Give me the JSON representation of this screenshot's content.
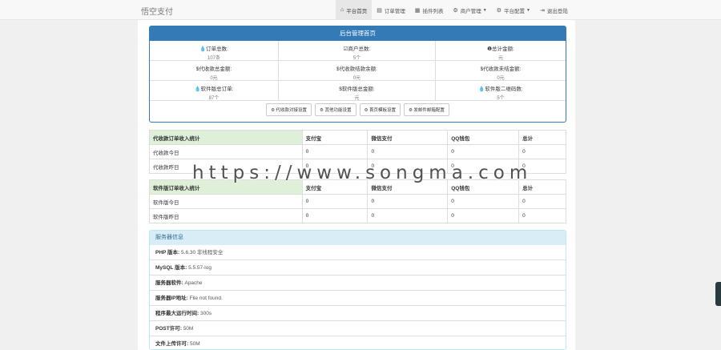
{
  "brand": "悟空支付",
  "nav": [
    {
      "icon": "⌂",
      "label": "平台首页",
      "active": true,
      "caret": false
    },
    {
      "icon": "▤",
      "label": "订单管理",
      "active": false,
      "caret": false
    },
    {
      "icon": "▦",
      "label": "插件列表",
      "active": false,
      "caret": false
    },
    {
      "icon": "⚙",
      "label": "商户管理",
      "active": false,
      "caret": true
    },
    {
      "icon": "⚙",
      "label": "平台配置",
      "active": false,
      "caret": true
    },
    {
      "icon": "⇥",
      "label": "退出登陆",
      "active": false,
      "caret": false
    }
  ],
  "panel": {
    "title": "后台管理首页",
    "stats": [
      {
        "label": "💧订单总数:",
        "value": "107条"
      },
      {
        "label": "☑商户总数:",
        "value": "5个"
      },
      {
        "label": "❶总计金额:",
        "value": "元"
      },
      {
        "label": "$代收款总金额:",
        "value": "0元"
      },
      {
        "label": "$代收款结款余额:",
        "value": "0元"
      },
      {
        "label": "$代收款未结金额:",
        "value": "0元"
      },
      {
        "label": "💧软件版总订单:",
        "value": "87个"
      },
      {
        "label": "$软件版总金额:",
        "value": "元"
      },
      {
        "label": "💧软件版二维码数:",
        "value": "5个"
      }
    ],
    "buttons": [
      "⚙ 代收款对接设置",
      "⚙ 其他功能设置",
      "⚙ 首页模板设置",
      "⚙ 发邮件邮箱配置"
    ]
  },
  "table1": {
    "headers": [
      "代收款订单收入统计",
      "支付宝",
      "微信支付",
      "QQ钱包",
      "总计"
    ],
    "rows": [
      [
        "代收款今日",
        "0",
        "0",
        "0",
        "0"
      ],
      [
        "代收款昨日",
        "0",
        "0",
        "0",
        "0"
      ]
    ]
  },
  "table2": {
    "headers": [
      "软件版订单收入统计",
      "支付宝",
      "微信支付",
      "QQ钱包",
      "总计"
    ],
    "rows": [
      [
        "软件版今日",
        "0",
        "0",
        "0",
        "0"
      ],
      [
        "软件版昨日",
        "0",
        "0",
        "0",
        "0"
      ]
    ]
  },
  "server": {
    "title": "服务器信息",
    "rows": [
      {
        "label": "PHP 版本:",
        "value": "5.6.30 非线程安全"
      },
      {
        "label": "MySQL 版本:",
        "value": "5.5.57-log"
      },
      {
        "label": "服务器软件:",
        "value": "Apache"
      },
      {
        "label": "服务器IP地址:",
        "value": "File not found."
      },
      {
        "label": "程序最大运行时间:",
        "value": "300s"
      },
      {
        "label": "POST许可:",
        "value": "50M"
      },
      {
        "label": "文件上传许可:",
        "value": "50M"
      }
    ]
  },
  "watermark": "https://www.songma.com"
}
